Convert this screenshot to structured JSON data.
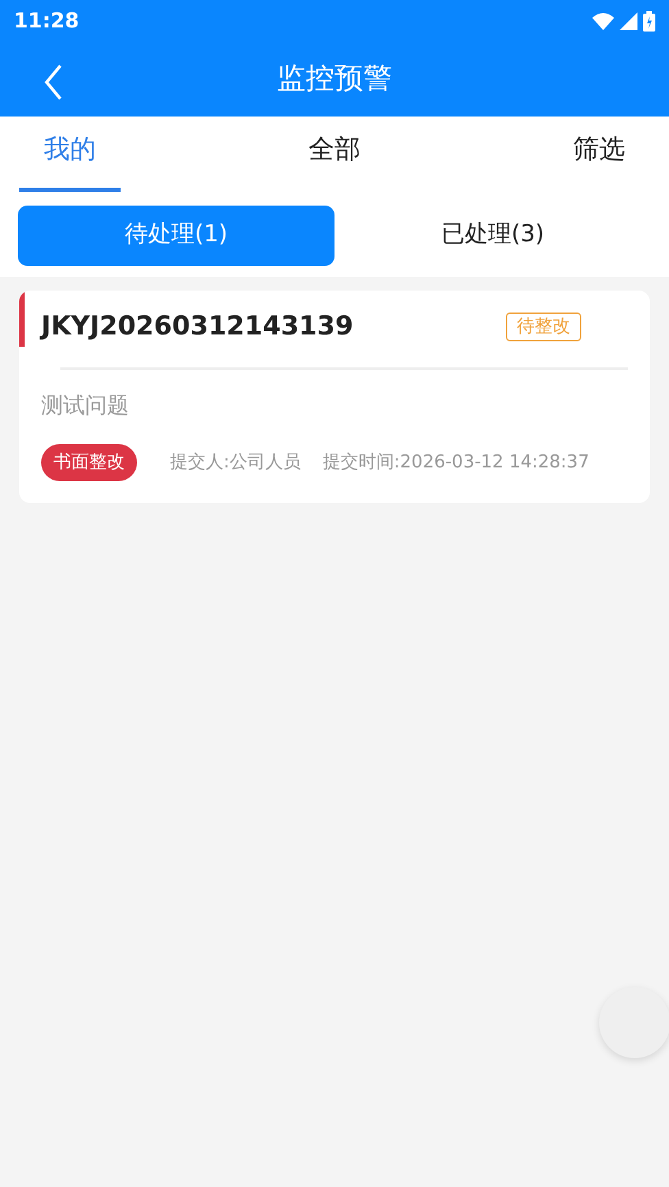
{
  "status_bar": {
    "time": "11:28"
  },
  "header": {
    "title": "监控预警"
  },
  "tabs": [
    {
      "label": "我的",
      "selected": true
    },
    {
      "label": "全部",
      "selected": false
    },
    {
      "label": "筛选",
      "selected": false
    }
  ],
  "subtabs": [
    {
      "label": "待处理(1)",
      "selected": true
    },
    {
      "label": "已处理(3)",
      "selected": false
    }
  ],
  "items": [
    {
      "code": "JKYJ20260312143139",
      "status": "待整改",
      "description": "测试问题",
      "tag": "书面整改",
      "submitter": "提交人:公司人员",
      "time": "提交时间:2026-03-12 14:28:37"
    }
  ]
}
